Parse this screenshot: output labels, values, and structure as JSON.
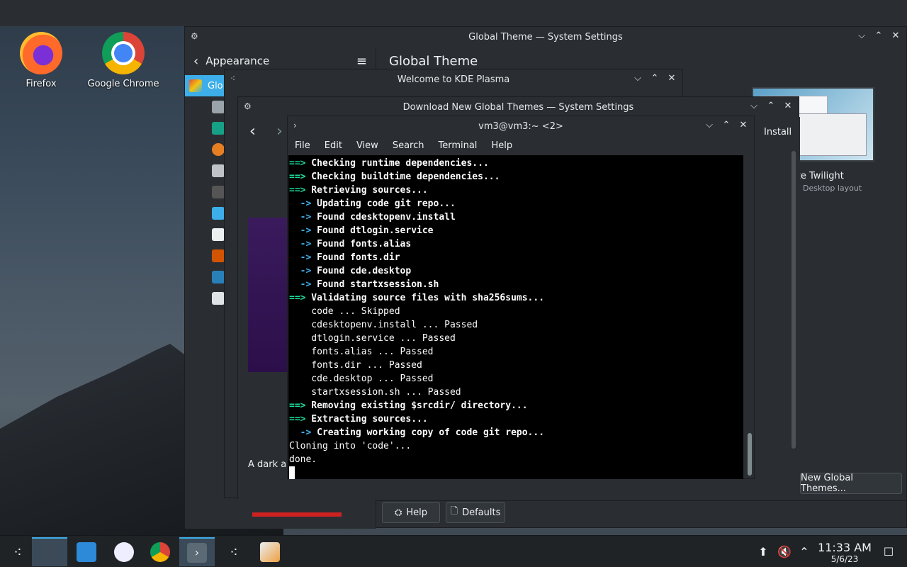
{
  "desktop": {
    "icons": [
      {
        "label": "Firefox"
      },
      {
        "label": "Google Chrome"
      }
    ]
  },
  "system_settings": {
    "title": "Global Theme — System Settings",
    "back_label": "Appearance",
    "page_title": "Global Theme",
    "sidebar_active": "Glo",
    "theme_name": "ze Twilight",
    "theme_sub": "Desktop layout",
    "get_new_label": "New Global Themes...",
    "help_label": "Help",
    "defaults_label": "Defaults"
  },
  "welcome": {
    "title": "Welcome to KDE Plasma"
  },
  "download": {
    "title": "Download New Global Themes — System Settings",
    "install_label": "Install",
    "description": "A dark ar"
  },
  "konsole": {
    "title": "vm3@vm3:~ <2>",
    "menu": [
      "File",
      "Edit",
      "View",
      "Search",
      "Terminal",
      "Help"
    ],
    "lines": [
      {
        "prefix": "==>",
        "text": " Checking runtime dependencies...",
        "kind": "main"
      },
      {
        "prefix": "==>",
        "text": " Checking buildtime dependencies...",
        "kind": "main"
      },
      {
        "prefix": "==>",
        "text": " Retrieving sources...",
        "kind": "main"
      },
      {
        "prefix": "  ->",
        "text": " Updating code git repo...",
        "kind": "sub"
      },
      {
        "prefix": "  ->",
        "text": " Found cdesktopenv.install",
        "kind": "sub"
      },
      {
        "prefix": "  ->",
        "text": " Found dtlogin.service",
        "kind": "sub"
      },
      {
        "prefix": "  ->",
        "text": " Found fonts.alias",
        "kind": "sub"
      },
      {
        "prefix": "  ->",
        "text": " Found fonts.dir",
        "kind": "sub"
      },
      {
        "prefix": "  ->",
        "text": " Found cde.desktop",
        "kind": "sub"
      },
      {
        "prefix": "  ->",
        "text": " Found startxsession.sh",
        "kind": "sub"
      },
      {
        "prefix": "==>",
        "text": " Validating source files with sha256sums...",
        "kind": "main"
      },
      {
        "prefix": "",
        "text": "    code ... Skipped",
        "kind": "plain"
      },
      {
        "prefix": "",
        "text": "    cdesktopenv.install ... Passed",
        "kind": "plain"
      },
      {
        "prefix": "",
        "text": "    dtlogin.service ... Passed",
        "kind": "plain"
      },
      {
        "prefix": "",
        "text": "    fonts.alias ... Passed",
        "kind": "plain"
      },
      {
        "prefix": "",
        "text": "    fonts.dir ... Passed",
        "kind": "plain"
      },
      {
        "prefix": "",
        "text": "    cde.desktop ... Passed",
        "kind": "plain"
      },
      {
        "prefix": "",
        "text": "    startxsession.sh ... Passed",
        "kind": "plain"
      },
      {
        "prefix": "==>",
        "text": " Removing existing $srcdir/ directory...",
        "kind": "main"
      },
      {
        "prefix": "==>",
        "text": " Extracting sources...",
        "kind": "main"
      },
      {
        "prefix": "  ->",
        "text": " Creating working copy of code git repo...",
        "kind": "sub"
      },
      {
        "prefix": "",
        "text": "Cloning into 'code'...",
        "kind": "plain"
      },
      {
        "prefix": "",
        "text": "done.",
        "kind": "plain"
      }
    ]
  },
  "taskbar": {
    "time": "11:33 AM",
    "date": "5/6/23"
  },
  "colors": {
    "accent": "#3daee9",
    "prompt_green": "#1cdc9a",
    "terminal_bg": "#000000",
    "panel_bg": "#2a2e32"
  }
}
